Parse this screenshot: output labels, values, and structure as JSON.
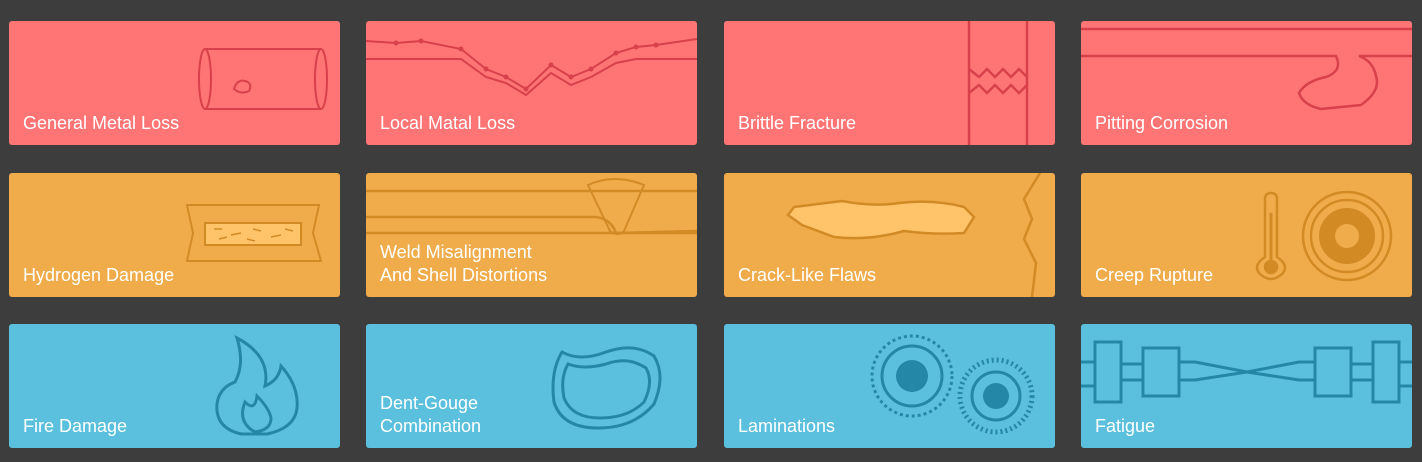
{
  "colors": {
    "background": "#3d3d3d",
    "red": "#ff7575",
    "red_line": "#d8404b",
    "orange": "#f0ac4b",
    "orange_line": "#d28a25",
    "blue": "#5ac0de",
    "blue_line": "#2587a8",
    "label_text": "#ffffff"
  },
  "tiles": [
    {
      "label": "General Metal Loss",
      "icon": "pipe-hole-icon"
    },
    {
      "label": "Local Matal Loss",
      "icon": "wall-thinning-icon"
    },
    {
      "label": "Brittle Fracture",
      "icon": "fracture-icon"
    },
    {
      "label": "Pitting Corrosion",
      "icon": "pit-icon"
    },
    {
      "label": "Hydrogen Damage",
      "icon": "hydrogen-blister-icon"
    },
    {
      "label": "Weld Misalignment\nAnd Shell Distortions",
      "icon": "weld-icon"
    },
    {
      "label": "Crack-Like Flaws",
      "icon": "crack-icon"
    },
    {
      "label": "Creep Rupture",
      "icon": "thermometer-gauge-icon"
    },
    {
      "label": "Fire Damage",
      "icon": "flame-icon"
    },
    {
      "label": "Dent-Gouge\nCombination",
      "icon": "dent-icon"
    },
    {
      "label": "Laminations",
      "icon": "lamination-gears-icon"
    },
    {
      "label": "Fatigue",
      "icon": "fatigue-specimen-icon"
    }
  ]
}
